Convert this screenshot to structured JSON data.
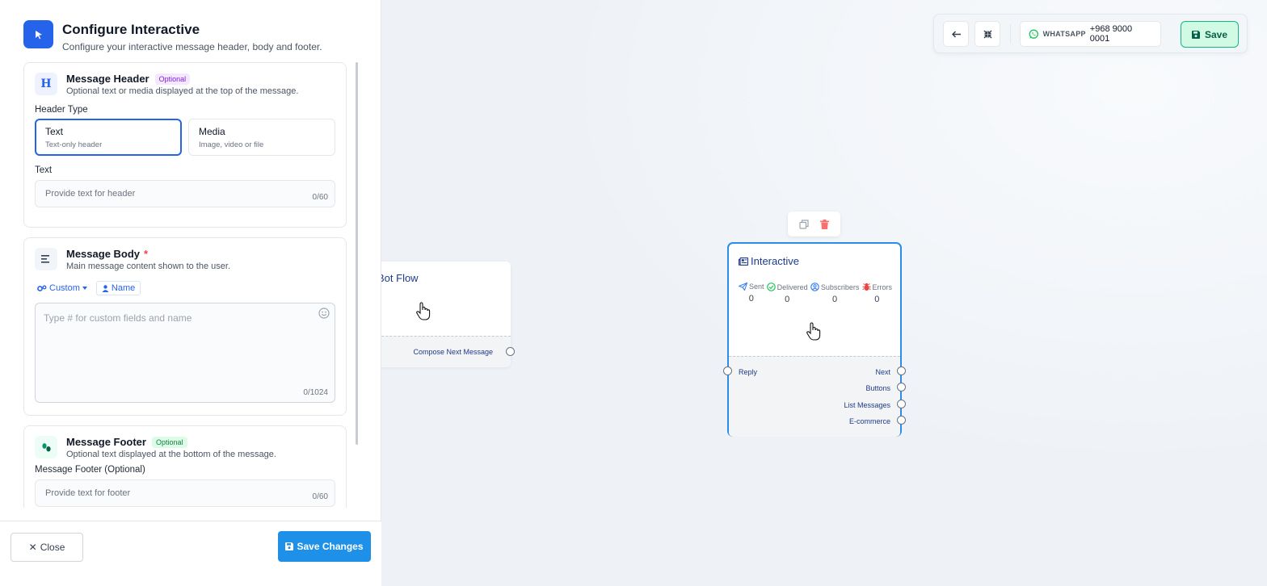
{
  "panel": {
    "title": "Configure Interactive",
    "subtitle": "Configure your interactive message header, body and footer."
  },
  "header_card": {
    "icon_letter": "H",
    "title": "Message Header",
    "badge": "Optional",
    "subtitle": "Optional text or media displayed at the top of the message.",
    "type_label": "Header Type",
    "types": [
      {
        "name": "Text",
        "desc": "Text-only header",
        "selected": true
      },
      {
        "name": "Media",
        "desc": "Image, video or file",
        "selected": false
      }
    ],
    "text_label": "Text",
    "text_value": "",
    "text_placeholder": "Provide text for header",
    "text_counter": "0/60"
  },
  "body_card": {
    "title": "Message Body",
    "required_mark": "*",
    "subtitle": "Main message content shown to the user.",
    "custom_chip": "Custom",
    "name_chip": "Name",
    "body_value": "",
    "body_placeholder": "Type # for custom fields and name",
    "body_counter": "0/1024"
  },
  "footer_card": {
    "title": "Message Footer",
    "badge": "Optional",
    "subtitle": "Optional text displayed at the bottom of the message.",
    "field_label": "Message Footer (Optional)",
    "footer_value": "",
    "footer_placeholder": "Provide text for footer",
    "footer_counter": "0/60"
  },
  "footer_bar": {
    "close_label": "Close",
    "close_glyph": "✕",
    "save_label": "Save Changes"
  },
  "toolbar": {
    "channel": "WHATSAPP",
    "phone": "+968 9000 0001",
    "save_label": "Save"
  },
  "bot_node": {
    "title": "Bot Flow",
    "output": "Compose Next Message"
  },
  "interactive_node": {
    "title": "Interactive",
    "stats": [
      {
        "label": "Sent",
        "value": "0",
        "icon": "send-icon",
        "color": "#3b82f6"
      },
      {
        "label": "Delivered",
        "value": "0",
        "icon": "check-circle-icon",
        "color": "#22c55e"
      },
      {
        "label": "Subscribers",
        "value": "0",
        "icon": "user-circle-icon",
        "color": "#3b82f6"
      },
      {
        "label": "Errors",
        "value": "0",
        "icon": "bug-icon",
        "color": "#ef4444"
      }
    ],
    "input": "Reply",
    "outputs": [
      "Next",
      "Buttons",
      "List Messages",
      "E-commerce"
    ]
  },
  "colors": {
    "primary": "#2563eb",
    "save_changes": "#1e90e8",
    "save_green_bg": "#d1fae5",
    "node_border": "#2b8de8"
  }
}
